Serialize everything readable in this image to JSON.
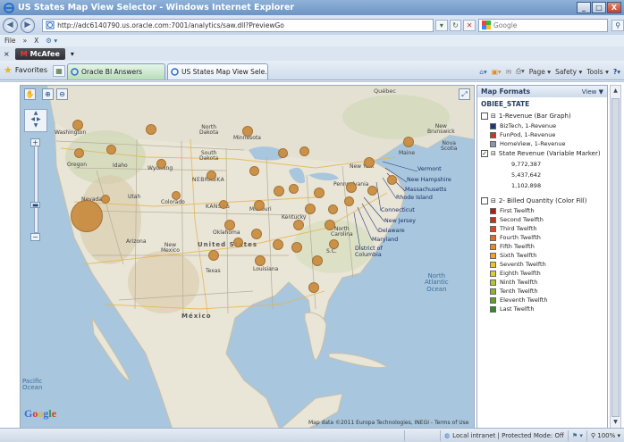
{
  "window": {
    "title": "US States Map View Selector - Windows Internet Explorer",
    "controls": [
      "_",
      "□",
      "X"
    ]
  },
  "address_bar": {
    "url": "http://adc6140790.us.oracle.com:7001/analytics/saw.dll?PreviewGo",
    "search_placeholder": "Google"
  },
  "menu": {
    "file": "File",
    "chevrons": "»",
    "x_label": "X"
  },
  "addon": {
    "mcafee": "McAfee",
    "mcafee_mark": "M"
  },
  "tabs": {
    "favorites": "Favorites",
    "items": [
      {
        "label": "Oracle BI Answers"
      },
      {
        "label": "US States Map View Sele..."
      }
    ],
    "close": "X"
  },
  "command_bar": {
    "page": "Page",
    "safety": "Safety",
    "tools": "Tools"
  },
  "map": {
    "labels": {
      "quebec": "Québec",
      "washington": "Washington",
      "north_dakota": "North\nDakota",
      "minnesota": "Minnesota",
      "south_dakota": "South\nDakota",
      "oregon": "Oregon",
      "idaho": "Idaho",
      "wyoming": "Wyoming",
      "nevada": "Nevada",
      "utah": "Utah",
      "colorado": "Colorado",
      "nebraska": "NEBRASKA",
      "kansas": "KANSAS",
      "missouri": "Missouri",
      "arizona": "Arizona",
      "new_mexico": "New\nMexico",
      "oklahoma": "Oklahoma",
      "texas": "Texas",
      "louisiana": "Louisiana",
      "united_states": "United States",
      "mexico": "México",
      "pennsylvania": "Pennsylvania",
      "kentucky": "Kentucky",
      "north_carolina": "North\nCarolina",
      "south_carolina": "S.C.",
      "maine": "Maine",
      "nova_scotia": "Nova\nScotia",
      "new_brunswick": "New\nBrunswick",
      "new_york": "New York",
      "vermont": "Vermont",
      "new_hampshire": "New Hampshire",
      "massachusetts": "Massachusetts",
      "rhode_island": "Rhode Island",
      "connecticut": "Connecticut",
      "new_jersey": "New Jersey",
      "delaware": "Delaware",
      "maryland": "Maryland",
      "district_of_columbia": "District of\nColumbia",
      "north_atlantic": "North\nAtlantic\nOcean",
      "pacific": "Pacific\nOcean",
      "google": "Google",
      "attribution": "Map data ©2011 Europa Technologies, INEGI - Terms of Use"
    }
  },
  "panel": {
    "title": "Map Formats",
    "view": "View",
    "layer": "OBIEE_STATE",
    "formats": [
      {
        "name": "1-Revenue (Bar Graph)",
        "checked": false,
        "items": [
          {
            "label": "BizTech, 1-Revenue",
            "color": "#1f3a7a"
          },
          {
            "label": "FunPod, 1-Revenue",
            "color": "#c0392b"
          },
          {
            "label": "HomeView, 1-Revenue",
            "color": "#8a97a8"
          }
        ]
      },
      {
        "name": "State Revenue (Variable Marker)",
        "checked": true,
        "values": [
          "9,772,387",
          "5,437,642",
          "1,102,898"
        ]
      },
      {
        "name": "2- Billed Quantity (Color Fill)",
        "checked": false,
        "items": [
          {
            "label": "First Twelfth",
            "color": "#b01d14"
          },
          {
            "label": "Second Twelfth",
            "color": "#c7331a"
          },
          {
            "label": "Third Twelfth",
            "color": "#d8491f"
          },
          {
            "label": "Fourth Twelfth",
            "color": "#e26a22"
          },
          {
            "label": "Fifth Twelfth",
            "color": "#e88a25"
          },
          {
            "label": "Sixth Twelfth",
            "color": "#eba629"
          },
          {
            "label": "Seventh Twelfth",
            "color": "#e8c22c"
          },
          {
            "label": "Eighth Twelfth",
            "color": "#d6cf2d"
          },
          {
            "label": "Ninth Twelfth",
            "color": "#b4c62c"
          },
          {
            "label": "Tenth Twelfth",
            "color": "#8cb52a"
          },
          {
            "label": "Eleventh Twelfth",
            "color": "#5fa027"
          },
          {
            "label": "Last Twelfth",
            "color": "#2f8a25"
          }
        ]
      }
    ]
  },
  "status_bar": {
    "zone": "Local intranet | Protected Mode: Off",
    "zoom": "100%"
  }
}
